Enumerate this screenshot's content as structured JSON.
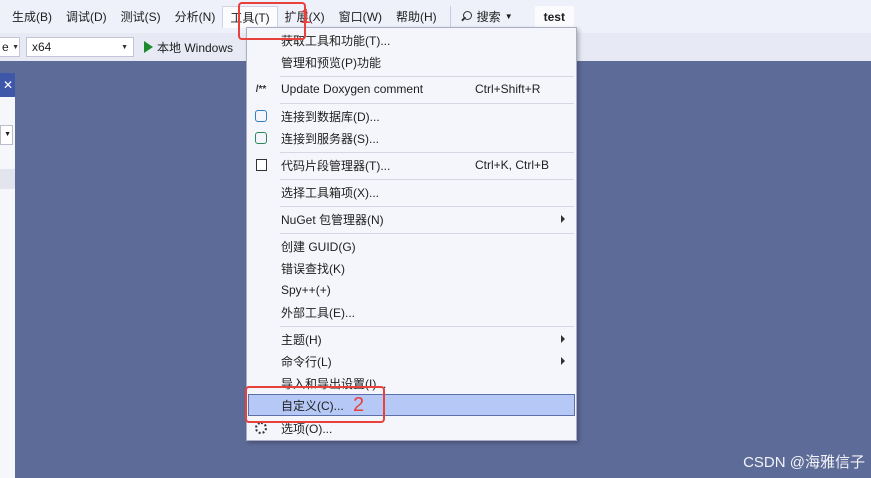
{
  "menubar": {
    "items": [
      "生成(B)",
      "调试(D)",
      "测试(S)",
      "分析(N)",
      "工具(T)",
      "扩展(X)",
      "窗口(W)",
      "帮助(H)"
    ],
    "search_label": "搜索",
    "project_name": "test"
  },
  "toolbar": {
    "config_value": "e",
    "platform_value": "x64",
    "run_label": "本地 Windows"
  },
  "left_panel": {
    "close_glyph": "✕"
  },
  "tools_menu": {
    "items": [
      {
        "label": "获取工具和功能(T)...",
        "shortcut": "",
        "icon": "none"
      },
      {
        "label": "管理和预览(P)功能",
        "shortcut": "",
        "icon": "none"
      },
      {
        "label": "Update Doxygen comment",
        "shortcut": "Ctrl+Shift+R",
        "icon": "doxygen-icon",
        "icon_text": "/**"
      },
      {
        "label": "连接到数据库(D)...",
        "shortcut": "",
        "icon": "database-icon"
      },
      {
        "label": "连接到服务器(S)...",
        "shortcut": "",
        "icon": "server-icon"
      },
      {
        "label": "代码片段管理器(T)...",
        "shortcut": "Ctrl+K, Ctrl+B",
        "icon": "snippet-icon"
      },
      {
        "label": "选择工具箱项(X)...",
        "shortcut": "",
        "icon": "none"
      },
      {
        "label": "NuGet 包管理器(N)",
        "shortcut": "",
        "icon": "none",
        "submenu": true
      },
      {
        "label": "创建 GUID(G)",
        "shortcut": "",
        "icon": "none"
      },
      {
        "label": "错误查找(K)",
        "shortcut": "",
        "icon": "none"
      },
      {
        "label": "Spy++(+)",
        "shortcut": "",
        "icon": "none"
      },
      {
        "label": "外部工具(E)...",
        "shortcut": "",
        "icon": "none"
      },
      {
        "label": "主题(H)",
        "shortcut": "",
        "icon": "none",
        "submenu": true
      },
      {
        "label": "命令行(L)",
        "shortcut": "",
        "icon": "none",
        "submenu": true
      },
      {
        "label": "导入和导出设置(I)...",
        "shortcut": "",
        "icon": "none"
      },
      {
        "label": "自定义(C)...",
        "shortcut": "",
        "icon": "none",
        "highlighted": true
      },
      {
        "label": "选项(O)...",
        "shortcut": "",
        "icon": "gear-icon"
      }
    ]
  },
  "annotations": {
    "step1": "1",
    "step2": "2",
    "color": "#e8403a"
  },
  "watermark": "CSDN @海雅信子"
}
